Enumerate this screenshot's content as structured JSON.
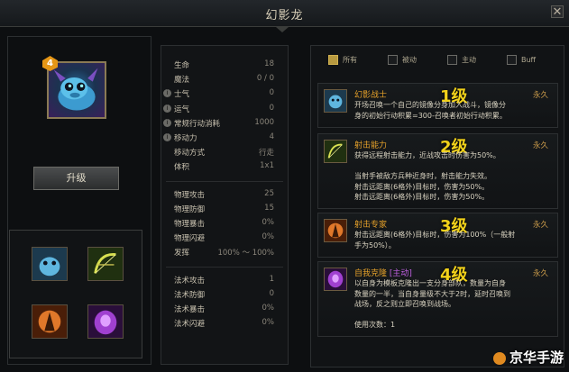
{
  "window": {
    "title": "幻影龙",
    "close_glyph": "✕"
  },
  "hero": {
    "level": "4",
    "upgrade_label": "升级"
  },
  "stats": [
    {
      "label": "生命",
      "value": "18",
      "info": false
    },
    {
      "label": "魔法",
      "value": "0 / 0",
      "info": false
    },
    {
      "label": "士气",
      "value": "0",
      "info": true
    },
    {
      "label": "运气",
      "value": "0",
      "info": true
    },
    {
      "label": "常规行动消耗",
      "value": "1000",
      "info": true
    },
    {
      "label": "移动力",
      "value": "4",
      "info": true
    },
    {
      "label": "移动方式",
      "value": "行走",
      "info": false
    },
    {
      "label": "体积",
      "value": "1x1",
      "info": false
    },
    {
      "label": "物理攻击",
      "value": "25",
      "info": false
    },
    {
      "label": "物理防御",
      "value": "15",
      "info": false
    },
    {
      "label": "物理暴击",
      "value": "0%",
      "info": false
    },
    {
      "label": "物理闪避",
      "value": "0%",
      "info": false
    },
    {
      "label": "发挥",
      "value": "100% ～ 100%",
      "info": false
    },
    {
      "label": "法术攻击",
      "value": "1",
      "info": false
    },
    {
      "label": "法术防御",
      "value": "0",
      "info": false
    },
    {
      "label": "法术暴击",
      "value": "0%",
      "info": false
    },
    {
      "label": "法术闪避",
      "value": "0%",
      "info": false
    }
  ],
  "filters": [
    {
      "label": "所有",
      "checked": true
    },
    {
      "label": "被动",
      "checked": false
    },
    {
      "label": "主动",
      "checked": false
    },
    {
      "label": "Buff",
      "checked": false
    }
  ],
  "skills": [
    {
      "name": "幻影战士",
      "tag": "",
      "level_label": "1级",
      "duration": "永久",
      "icon": "phantom-warrior-icon",
      "desc": "开场召唤一个自己的镜像分身加入战斗，镜像分\n身的初始行动积累=300-召唤者初始行动积累。"
    },
    {
      "name": "射击能力",
      "tag": "",
      "level_label": "2级",
      "duration": "永久",
      "icon": "bow-icon",
      "desc": "获得远程射击能力，近战攻击时伤害为50%。\n\n当射手被敌方兵种近身时，射击能力失效。\n射击远距离(6格外)目标时，伤害为50%。\n射击远距离(6格外)目标时，伤害为50%。"
    },
    {
      "name": "射击专家",
      "tag": "",
      "level_label": "3级",
      "duration": "永久",
      "icon": "archer-expert-icon",
      "desc": "射击远距离(6格外)目标时，伤害为100%（一般射\n手为50%）。"
    },
    {
      "name": "自我克隆",
      "tag": "[主动]",
      "level_label": "4级",
      "duration": "永久",
      "icon": "self-clone-icon",
      "desc": "以自身为模板克隆出一支分身部队，数量为自身\n数量的一半，当自身量级不大于2时，延时召唤到\n战场，反之则立即召唤到战场。\n\n使用次数：1"
    }
  ],
  "watermark": "京华手游",
  "colors": {
    "accent_gold": "#e6a12a",
    "level_yellow": "#f2d21a",
    "badge_orange": "#e59616",
    "active_tag_purple": "#c060e0"
  }
}
